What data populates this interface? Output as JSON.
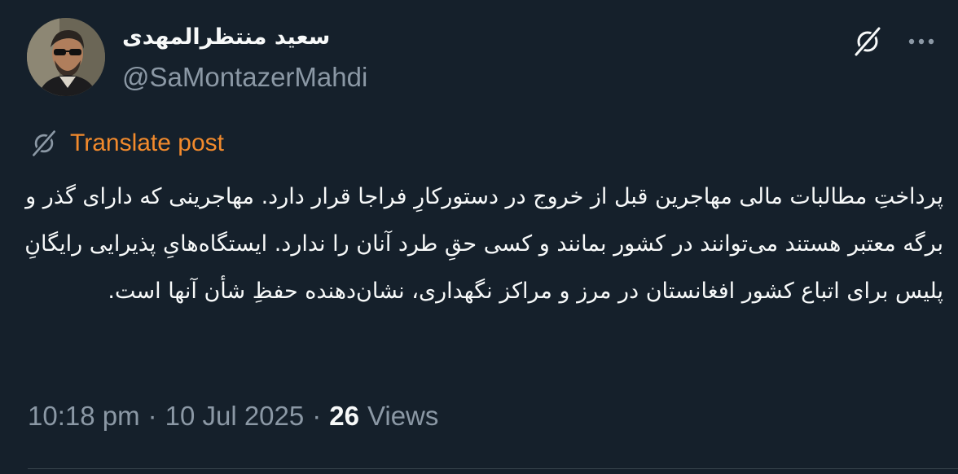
{
  "author": {
    "display_name": "سعید منتظرالمهدی",
    "handle": "@SaMontazerMahdi",
    "avatar_icon": "profile-photo"
  },
  "actions": {
    "grok_icon": "grok-icon",
    "more_icon": "more-dots-icon"
  },
  "translate": {
    "icon": "grok-icon",
    "label": "Translate post"
  },
  "post": {
    "text": "پرداختِ مطالبات مالی مهاجرین قبل از خروج در دستورکارِ فراجا قرار دارد. مهاجرینی که دارای گذر و برگه معتبر هستند می‌توانند در کشور بمانند و کسی حقِ طرد آنان را ندارد. ایستگاه‌هایِ پذیرایی رایگانِ پلیس برای اتباع کشور افغانستان در مرز و مراکز نگهداری، نشان‌دهنده حفظِ شأن آنها است."
  },
  "meta": {
    "time": "10:18 pm",
    "separator_1": "·",
    "date": "10 Jul 2025",
    "separator_2": "·",
    "views_count": "26",
    "views_label": "Views"
  },
  "colors": {
    "background": "#15202b",
    "text_primary": "#f7f9f9",
    "text_secondary": "#8b98a5",
    "translate_accent": "#f28a2c",
    "divider": "#38444d"
  }
}
